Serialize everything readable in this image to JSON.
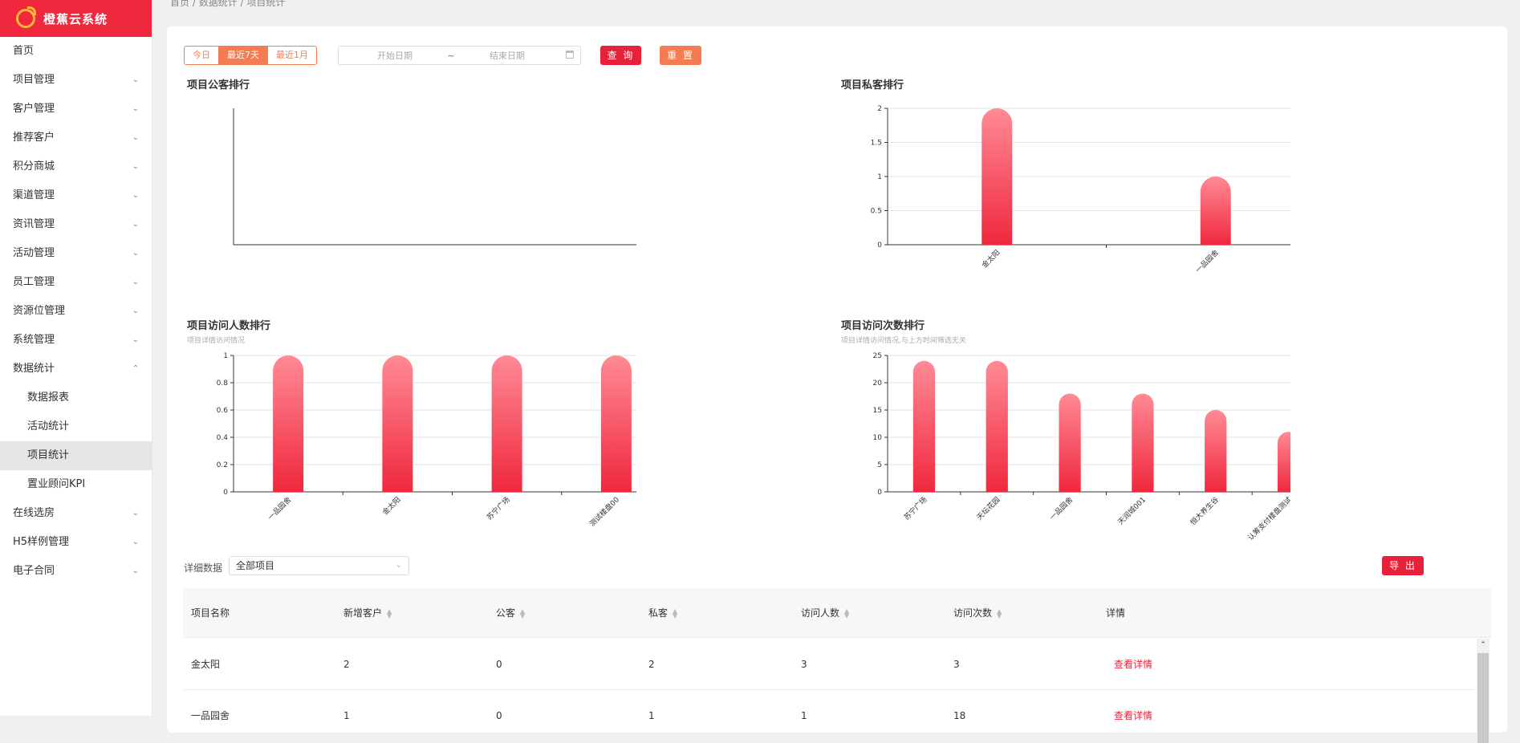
{
  "app": {
    "name": "橙蕉云系统"
  },
  "breadcrumb": [
    "首页",
    "数据统计",
    "项目统计"
  ],
  "sidebar": {
    "items": [
      {
        "label": "首页",
        "chev": ""
      },
      {
        "label": "项目管理",
        "chev": "⌄"
      },
      {
        "label": "客户管理",
        "chev": "⌄"
      },
      {
        "label": "推荐客户",
        "chev": "⌄"
      },
      {
        "label": "积分商城",
        "chev": "⌄"
      },
      {
        "label": "渠道管理",
        "chev": "⌄"
      },
      {
        "label": "资讯管理",
        "chev": "⌄"
      },
      {
        "label": "活动管理",
        "chev": "⌄"
      },
      {
        "label": "员工管理",
        "chev": "⌄"
      },
      {
        "label": "资源位管理",
        "chev": "⌄"
      },
      {
        "label": "系统管理",
        "chev": "⌄"
      },
      {
        "label": "数据统计",
        "chev": "⌃"
      }
    ],
    "subitems": [
      {
        "label": "数据报表"
      },
      {
        "label": "活动统计"
      },
      {
        "label": "项目统计"
      },
      {
        "label": "置业顾问KPI"
      }
    ],
    "items_after": [
      {
        "label": "在线选房",
        "chev": "⌄"
      },
      {
        "label": "H5样例管理",
        "chev": "⌄"
      },
      {
        "label": "电子合同",
        "chev": "⌄"
      }
    ]
  },
  "filter": {
    "ranges": [
      "今日",
      "最近7天",
      "最近1月"
    ],
    "active_range": "最近7天",
    "start_placeholder": "开始日期",
    "range_separator": "~",
    "end_placeholder": "结束日期",
    "query_label": "查 询",
    "reset_label": "重 置"
  },
  "chart_data": [
    {
      "type": "bar",
      "title": "项目公客排行",
      "subtitle": "",
      "categories": [],
      "values": []
    },
    {
      "type": "bar",
      "title": "项目私客排行",
      "subtitle": "",
      "categories": [
        "金太阳",
        "一品园舍"
      ],
      "values": [
        2,
        1
      ],
      "ylim": [
        0,
        2
      ],
      "yticks": [
        "0",
        "0.5",
        "1",
        "1.5",
        "2"
      ],
      "grid": true
    },
    {
      "type": "bar",
      "title": "项目访问人数排行",
      "subtitle": "项目详情访问情况",
      "categories": [
        "一品园舍",
        "金太阳",
        "苏宁广场",
        "测试楼盘00"
      ],
      "values": [
        1,
        1,
        1,
        1
      ],
      "ylim": [
        0,
        1
      ],
      "yticks": [
        "0",
        "0.2",
        "0.4",
        "0.6",
        "0.8",
        "1"
      ],
      "grid": true
    },
    {
      "type": "bar",
      "title": "项目访问次数排行",
      "subtitle": "项目详情访问情况,与上方时间筛选无关",
      "categories": [
        "苏宁广场",
        "天坛花园",
        "一品园舍",
        "天润城001",
        "恒大养生谷",
        "认筹支付楼盘测试"
      ],
      "values": [
        24,
        24,
        18,
        18,
        15,
        11
      ],
      "ylim": [
        0,
        25
      ],
      "yticks": [
        "0",
        "5",
        "10",
        "15",
        "20",
        "25"
      ],
      "grid": true
    }
  ],
  "detail": {
    "label": "详细数据",
    "select_value": "全部项目",
    "export_label": "导 出",
    "columns": [
      "项目名称",
      "新增客户",
      "公客",
      "私客",
      "访问人数",
      "访问次数",
      "详情"
    ],
    "sortable": [
      false,
      true,
      true,
      true,
      true,
      true,
      false
    ],
    "rows": [
      [
        "金太阳",
        "2",
        "0",
        "2",
        "3",
        "3",
        "查看详情"
      ],
      [
        "一品园舍",
        "1",
        "0",
        "1",
        "1",
        "18",
        "查看详情"
      ]
    ]
  },
  "colors": {
    "brand": "#f0283d",
    "accent": "#f47c52",
    "bar_top": "#ff8a95",
    "bar_bottom": "#f0283d"
  }
}
